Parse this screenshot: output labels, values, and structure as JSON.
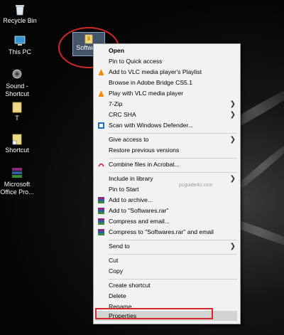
{
  "desktop": {
    "icons": [
      {
        "name": "recycle-bin",
        "label": "Recycle Bin"
      },
      {
        "name": "this-pc",
        "label": "This PC"
      },
      {
        "name": "sound-shortcut",
        "label": "Sound - Shortcut"
      },
      {
        "name": "t-file",
        "label": "T"
      },
      {
        "name": "shortcut",
        "label": "Shortcut"
      },
      {
        "name": "office-pro",
        "label": "Microsoft Office Pro..."
      }
    ],
    "selected_file": {
      "label": "Software"
    }
  },
  "menu": {
    "open": "Open",
    "pin_quick_access": "Pin to Quick access",
    "vlc_playlist": "Add to VLC media player's Playlist",
    "adobe_bridge": "Browse in Adobe Bridge CS5.1",
    "vlc_play": "Play with VLC media player",
    "zip": "7-Zip",
    "crc": "CRC SHA",
    "defender": "Scan with Windows Defender...",
    "give_access": "Give access to",
    "restore": "Restore previous versions",
    "combine_acrobat": "Combine files in Acrobat...",
    "include_library": "Include in library",
    "pin_start": "Pin to Start",
    "add_archive": "Add to archive...",
    "add_rar": "Add to \"Softwares.rar\"",
    "compress_email": "Compress and email...",
    "compress_rar_email": "Compress to \"Softwares.rar\" and email",
    "send_to": "Send to",
    "cut": "Cut",
    "copy": "Copy",
    "create_shortcut": "Create shortcut",
    "delete": "Delete",
    "rename": "Rename",
    "properties": "Properties",
    "watermark": "pcguide4u.com"
  },
  "colors": {
    "highlight_red": "#d62828",
    "menu_bg": "#f2f2f2"
  }
}
